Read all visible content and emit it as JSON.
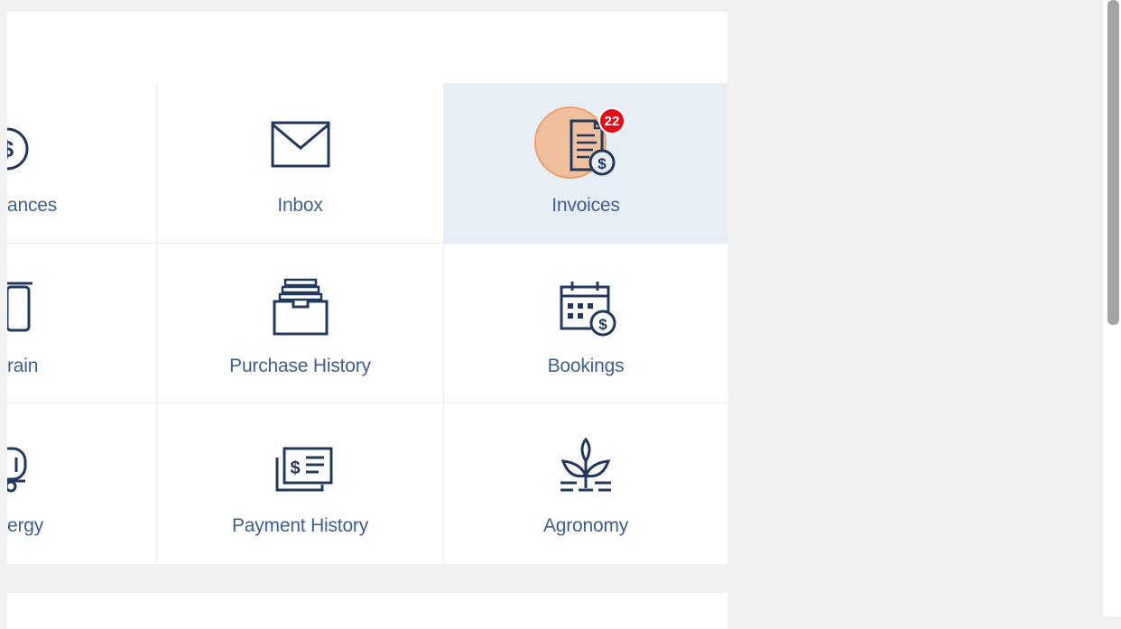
{
  "tiles": [
    {
      "label": "ances",
      "icon": "dollar-circle-icon"
    },
    {
      "label": "Inbox",
      "icon": "envelope-icon"
    },
    {
      "label": "Invoices",
      "icon": "invoice-dollar-icon",
      "badge": "22",
      "active": true
    },
    {
      "label": "rain",
      "icon": "grain-bin-icon"
    },
    {
      "label": "Purchase History",
      "icon": "file-drawer-icon"
    },
    {
      "label": "Bookings",
      "icon": "calendar-dollar-icon"
    },
    {
      "label": "ergy",
      "icon": "fuel-truck-icon"
    },
    {
      "label": "Payment History",
      "icon": "check-payment-icon"
    },
    {
      "label": "Agronomy",
      "icon": "plant-icon"
    }
  ],
  "colors": {
    "icon": "#23395b",
    "label": "#3d5f8a",
    "active_bg": "#e8eef6",
    "badge": "#e30e1a"
  }
}
